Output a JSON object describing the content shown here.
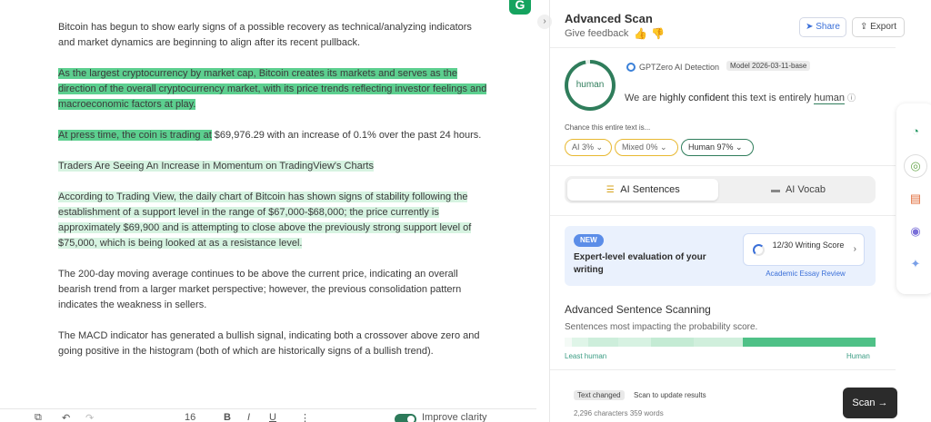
{
  "editor": {
    "paragraphs": [
      {
        "text": "Bitcoin has begun to show early signs of a possible recovery as technical/analyzing indicators and market dynamics are beginning to align after its recent pullback."
      },
      {
        "text": "As the largest cryptocurrency by market cap, Bitcoin creates its markets and serves as the direction of the overall cryptocurrency market, with its price trends reflecting investor feelings and macroeconomic factors at play."
      },
      {
        "text_highlight": "At press time, the coin is trading at",
        "text_rest": " $69,976.29 with an increase of 0.1% over the past 24 hours."
      },
      {
        "text": "Traders Are Seeing An Increase in Momentum on TradingView's Charts"
      },
      {
        "text": "According to Trading View, the daily chart of Bitcoin has shown signs of stability following the establishment of a support level in the range of $67,000-$68,000; the price currently is approximately $69,900 and is attempting to close above the previously strong support level of $75,000, which is being looked at as a resistance level."
      },
      {
        "text": "The 200-day moving average continues to be above the current price, indicating an overall bearish trend from a larger market perspective; however, the previous consolidation pattern indicates the weakness in sellers."
      },
      {
        "text": "The MACD indicator has generated a bullish signal, indicating both a crossover above zero and going positive in the histogram (both of which are historically signs of a bullish trend)."
      }
    ],
    "toolbar": {
      "font_size": "16",
      "bold": "B",
      "italic": "I",
      "underline": "U",
      "more": "⋮",
      "improve_label": "Improve clarity"
    },
    "grammarly_logo": "G",
    "collapse_icon": "›"
  },
  "panel": {
    "title": "Advanced Scan",
    "feedback": "Give feedback",
    "thumb_up": "👍",
    "thumb_down": "👎",
    "share": "Share",
    "export": "Export",
    "result_label": "human",
    "detector": "GPTZero AI Detection",
    "model": "Model 2026-03-11-base",
    "verdict_pre": "We are",
    "verdict_strong": "highly confident",
    "verdict_mid": "this text is entirely",
    "verdict_human": "human",
    "info": "ⓘ",
    "chance_label": "Chance this entire text is...",
    "pill_ai": "AI 3%",
    "pill_mixed": "Mixed 0%",
    "pill_human": "Human 97%",
    "human_fraction": 0.97,
    "tab_sentences": "AI Sentences",
    "tab_vocab": "AI Vocab",
    "new_badge": "NEW",
    "promo_text": "Expert-level evaluation of your writing",
    "writing_score": "12/30 Writing Score",
    "essay_link": "Academic Essay Review",
    "adv_title": "Advanced Sentence Scanning",
    "adv_sub": "Sentences most impacting the probability score.",
    "least_human": "Least human",
    "human": "Human",
    "text_changed": "Text changed",
    "scan_hint": "Scan to update results",
    "counts": "2,296 characters  359 words",
    "scan_btn": "Scan →",
    "colors": {
      "accent_green": "#2f7d5b",
      "highlight_green": "#5ccf8f",
      "promo_blue": "#eaf1fd",
      "scan_dark": "#2b2b2b"
    }
  }
}
